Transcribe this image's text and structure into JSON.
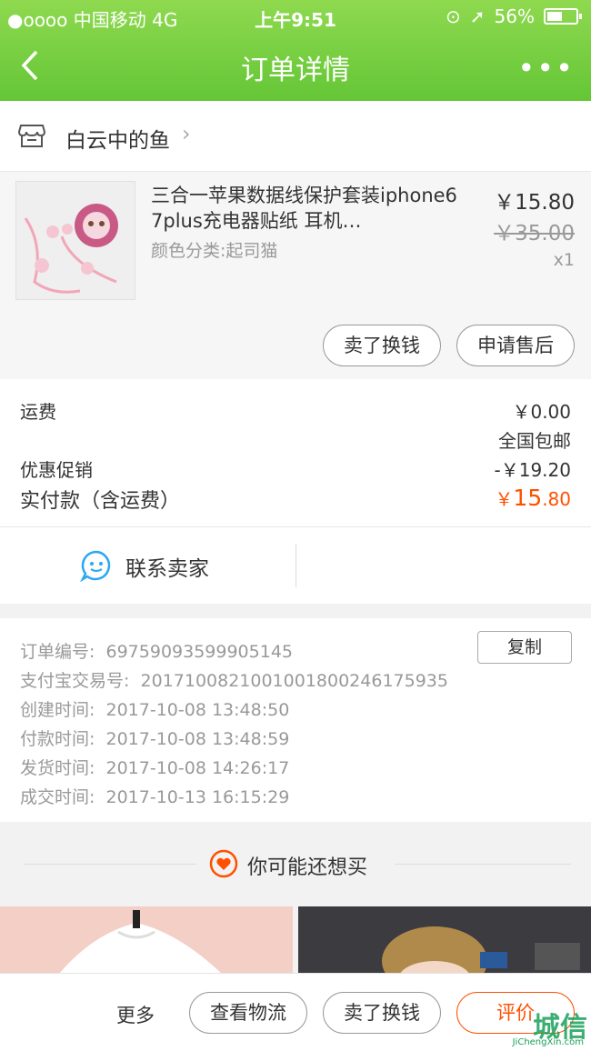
{
  "status_bar": {
    "carrier": "●oooo 中国移动  4G",
    "time": "上午9:51",
    "battery": "56%"
  },
  "nav": {
    "title": "订单详情",
    "more": "•••"
  },
  "shop": {
    "name": "白云中的鱼"
  },
  "product": {
    "title": "三合一苹果数据线保护套装iphone6 7plus充电器贴纸 耳机…",
    "sku": "颜色分类:起司猫",
    "price": "￥15.80",
    "original_price": "￥35.00",
    "quantity": "x1",
    "sell_button": "卖了换钱",
    "after_sale_button": "申请售后"
  },
  "summary": {
    "shipping_label": "运费",
    "shipping_value": "￥0.00",
    "shipping_note": "全国包邮",
    "discount_label": "优惠促销",
    "discount_value": "-￥19.20",
    "paid_label": "实付款（含运费）",
    "paid_currency": "￥",
    "paid_int": "15",
    "paid_dec": ".80"
  },
  "contact": {
    "label": "联系卖家"
  },
  "order_info": {
    "copy_button": "复制",
    "rows": [
      {
        "label": "订单编号:",
        "value": "69759093599905145"
      },
      {
        "label": "支付宝交易号:",
        "value": "2017100821001001800246175935"
      },
      {
        "label": "创建时间:",
        "value": "2017-10-08 13:48:50"
      },
      {
        "label": "付款时间:",
        "value": "2017-10-08 13:48:59"
      },
      {
        "label": "发货时间:",
        "value": "2017-10-08 14:26:17"
      },
      {
        "label": "成交时间:",
        "value": "2017-10-13 16:15:29"
      }
    ]
  },
  "recommend": {
    "label": "你可能还想买"
  },
  "bottom_bar": {
    "more": "更多",
    "logistics": "查看物流",
    "sell": "卖了换钱",
    "review": "评价"
  },
  "watermark": {
    "text": "城信",
    "sub": "JiChengXin.com"
  },
  "colors": {
    "header_green": "#6cc93c",
    "accent_orange": "#ff5000",
    "contact_blue": "#2aa8f2"
  }
}
